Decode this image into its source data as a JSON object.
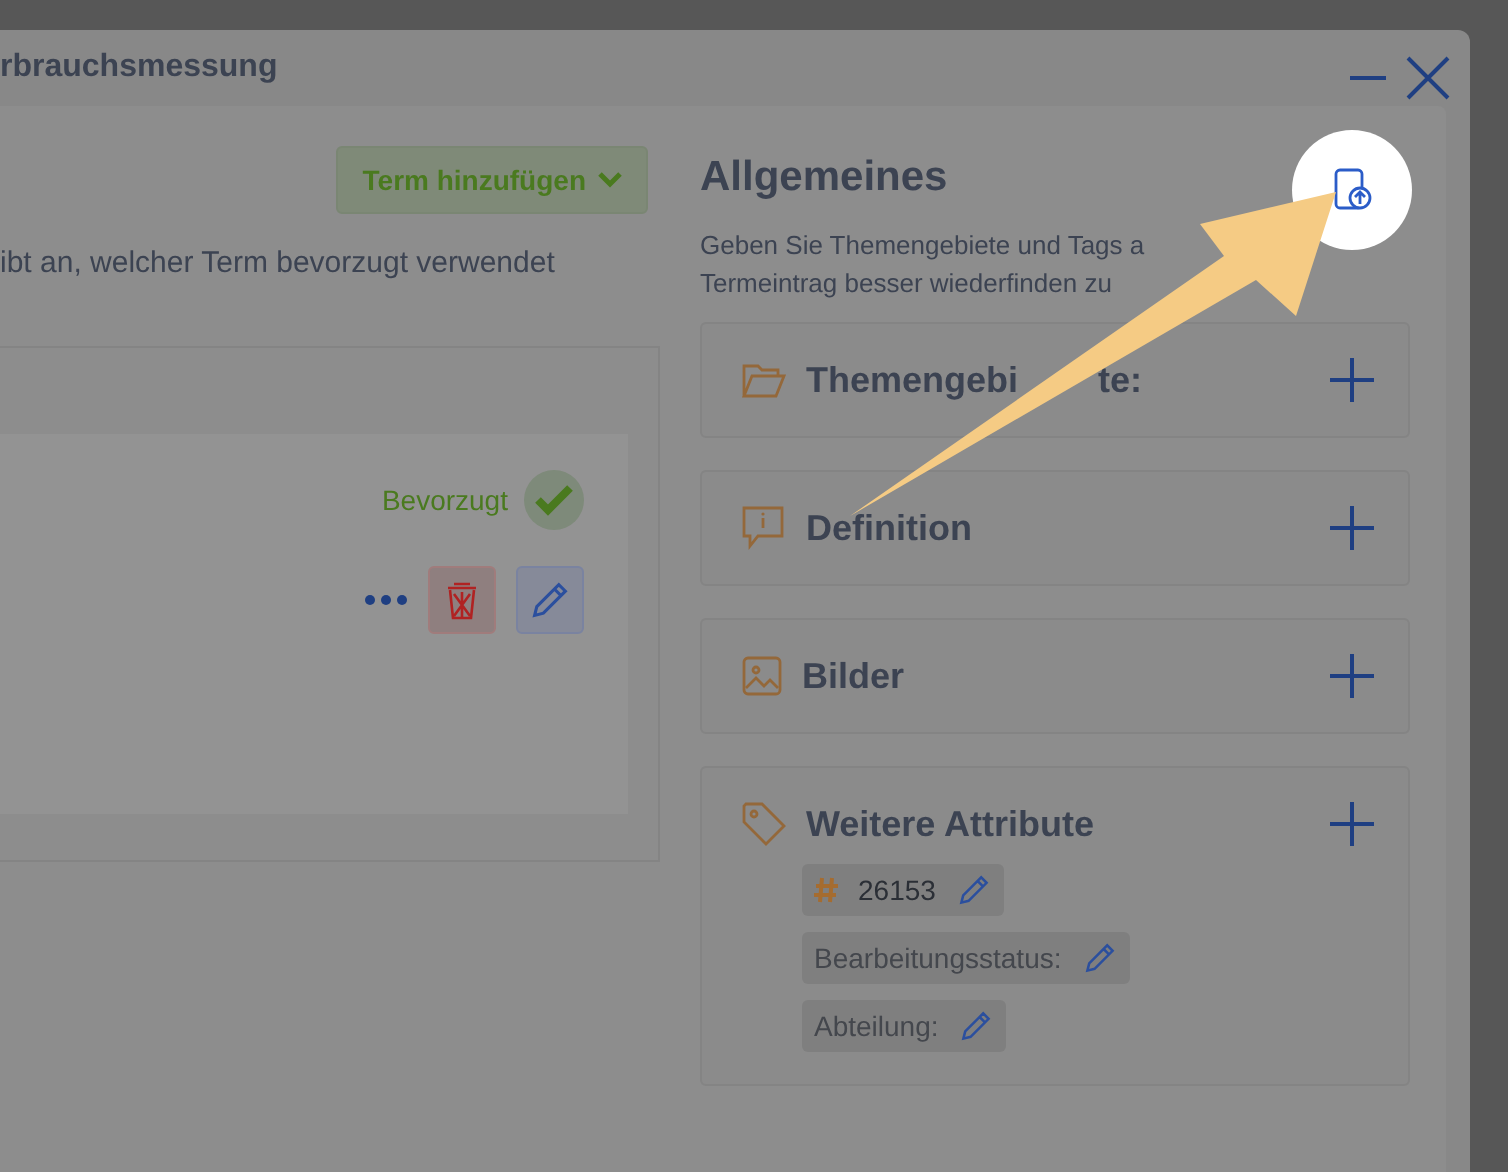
{
  "window": {
    "title": "rbrauchsmessung"
  },
  "term_panel": {
    "add_button": "Term hinzufügen",
    "hint": "ibt an, welcher Term bevorzugt verwendet",
    "term": {
      "preferred_label": "Bevorzugt",
      "preferred": true
    }
  },
  "general": {
    "title": "Allgemeines",
    "description": [
      "Geben Sie Themengebiete und Tags a",
      "Termeintrag besser wiederfinden zu"
    ],
    "sections": [
      {
        "kind": "topics",
        "label": "Themengebi",
        "label_end": "te:"
      },
      {
        "kind": "definition",
        "label": "Definition"
      },
      {
        "kind": "images",
        "label": "Bilder"
      },
      {
        "kind": "attributes",
        "label": "Weitere Attribute",
        "attributes": [
          {
            "kind": "id",
            "value": "26153"
          },
          {
            "kind": "empty",
            "label": "Bearbeitungsstatus:"
          },
          {
            "kind": "empty",
            "label": "Abteilung:"
          }
        ]
      }
    ]
  }
}
